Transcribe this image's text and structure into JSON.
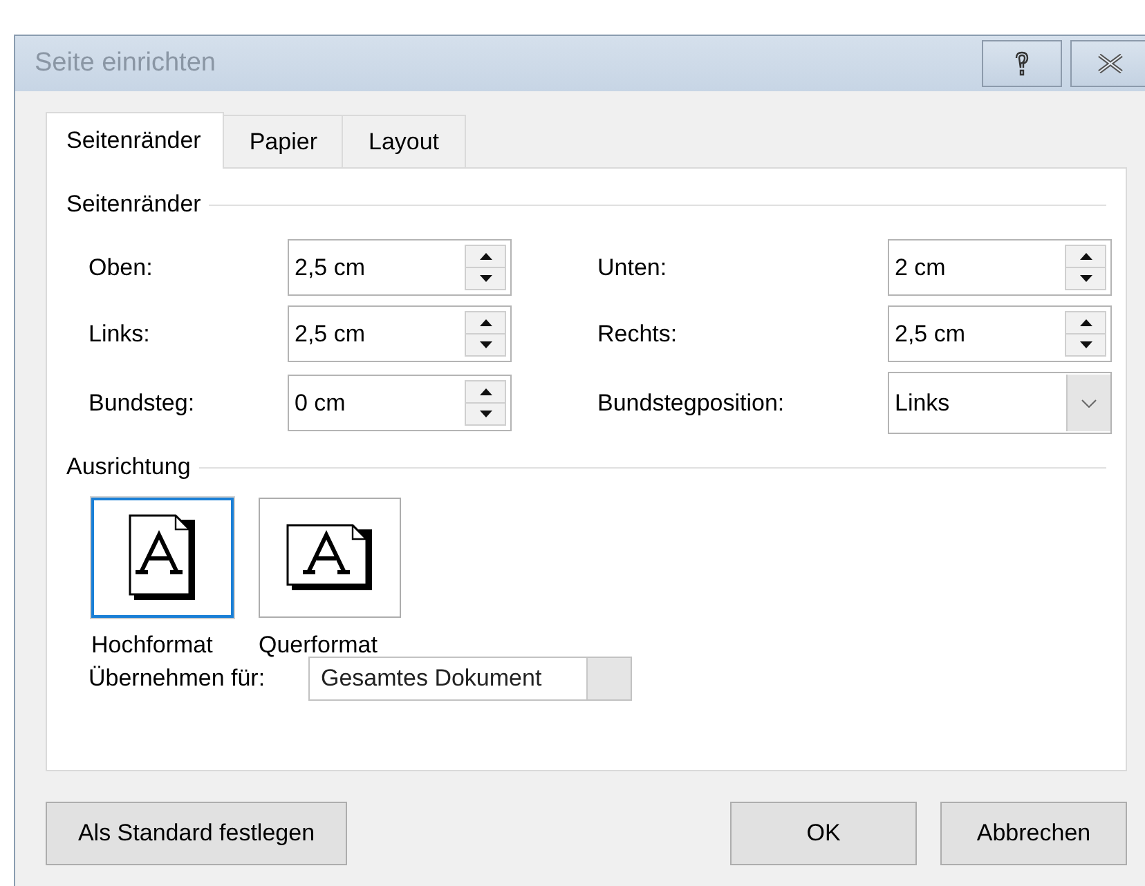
{
  "window": {
    "title": "Seite einrichten"
  },
  "tabs": [
    {
      "label": "Seitenränder",
      "selected": true
    },
    {
      "label": "Papier",
      "selected": false
    },
    {
      "label": "Layout",
      "selected": false
    }
  ],
  "margins": {
    "title": "Seitenränder",
    "fields": [
      {
        "kind": "spin",
        "label": "Oben:",
        "value": "2,5 cm"
      },
      {
        "kind": "spin",
        "label": "Unten:",
        "value": "2 cm"
      },
      {
        "kind": "spin",
        "label": "Links:",
        "value": "2,5 cm"
      },
      {
        "kind": "spin",
        "label": "Rechts:",
        "value": "2,5 cm"
      },
      {
        "kind": "spin",
        "label": "Bundsteg:",
        "value": "0 cm"
      },
      {
        "kind": "combo",
        "label": "Bundstegposition:",
        "value": "Links"
      }
    ]
  },
  "orientation": {
    "title": "Ausrichtung",
    "options": [
      {
        "kind": "portrait",
        "label": "Hochformat",
        "selected": true
      },
      {
        "kind": "landscape",
        "label": "Querformat",
        "selected": false
      }
    ]
  },
  "apply": {
    "label": "Übernehmen für:",
    "value": "Gesamtes Dokument"
  },
  "buttons": [
    {
      "label": "Als Standard festlegen"
    },
    {
      "label": "OK"
    },
    {
      "label": "Abbrechen"
    }
  ]
}
